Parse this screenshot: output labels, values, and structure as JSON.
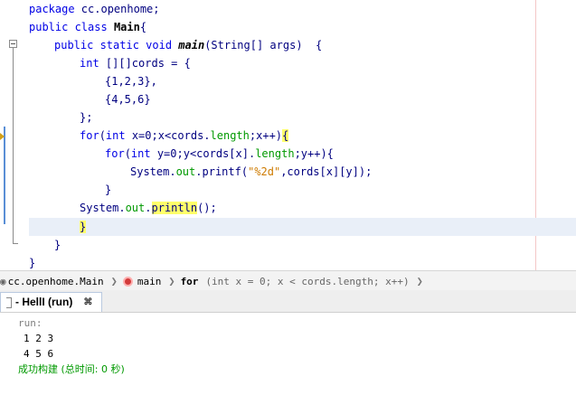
{
  "editor": {
    "lines": {
      "l1_kw": "package",
      "l1_rest": " cc.openhome;",
      "l2_kw": "public class",
      "l2_class": "Main",
      "l2_rest": "{",
      "l3_kw": "public static void",
      "l3_method": "main",
      "l3_rest": "(String[] args)  {",
      "l4_kw": "int",
      "l4_rest": " [][]cords = {",
      "l5": "{1,2,3},",
      "l6": "{4,5,6}",
      "l7": "};",
      "l8_kw": "for",
      "l8_a": "(",
      "l8_kw2": "int",
      "l8_b": " x=0;x<cords.",
      "l8_field": "length",
      "l8_c": ";x++)",
      "l8_brace": "{",
      "l9_kw": "for",
      "l9_a": "(",
      "l9_kw2": "int",
      "l9_b": " y=0;y<cords[x].",
      "l9_field": "length",
      "l9_c": ";y++){",
      "l10_a": "System.",
      "l10_field": "out",
      "l10_b": ".printf(",
      "l10_str": "\"%2d\"",
      "l10_c": ",cords[x][y]);",
      "l11": "}",
      "l12_a": "System.",
      "l12_field": "out",
      "l12_b": ".",
      "l12_method": "println",
      "l12_c": "();",
      "l13": "}",
      "l14": "}",
      "l15": "}"
    }
  },
  "breadcrumb": {
    "class_label": "cc.openhome.Main",
    "method_label": "main",
    "for_kw": "for",
    "for_detail": "(int x = 0; x < cords.length; x++)"
  },
  "output_panel": {
    "tab_label": "- HellI (run)",
    "close_glyph": "⌘",
    "run_label": "run:",
    "row1": "1 2 3",
    "row2": "4 5 6",
    "success": "成功构建 (总时间: 0 秒)"
  }
}
